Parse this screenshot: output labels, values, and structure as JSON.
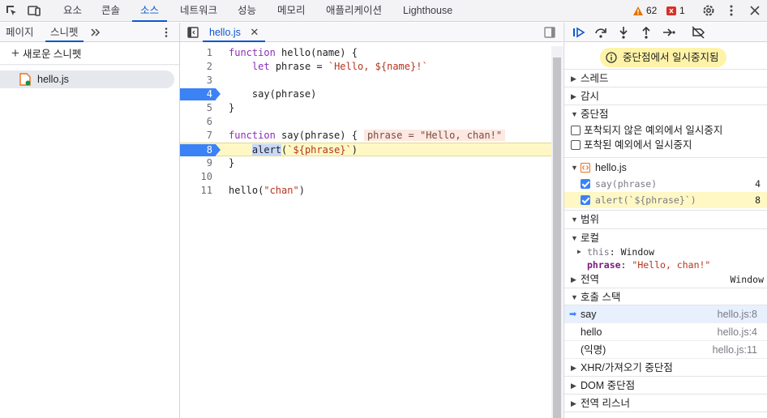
{
  "top_tabs": [
    "요소",
    "콘솔",
    "소스",
    "네트워크",
    "성능",
    "메모리",
    "애플리케이션",
    "Lighthouse"
  ],
  "active_tab": "소스",
  "warnings_count": "62",
  "errors_count": "1",
  "left_panel": {
    "tabs": [
      "페이지",
      "스니펫"
    ],
    "new_snippet_label": "새로운 스니펫",
    "file": "hello.js"
  },
  "editor": {
    "tab_label": "hello.js",
    "lines": [
      {
        "n": "1",
        "code": "function hello(name) {"
      },
      {
        "n": "2",
        "code": "    let phrase = `Hello, ${name}!`"
      },
      {
        "n": "3",
        "code": ""
      },
      {
        "n": "4",
        "code": "    say(phrase)"
      },
      {
        "n": "5",
        "code": "}"
      },
      {
        "n": "6",
        "code": ""
      },
      {
        "n": "7",
        "code": "function say(phrase) {"
      },
      {
        "n": "8",
        "code": "    alert(`${phrase}`)"
      },
      {
        "n": "9",
        "code": "}"
      },
      {
        "n": "10",
        "code": ""
      },
      {
        "n": "11",
        "code": "hello(\"chan\")"
      }
    ],
    "inline_value": "phrase = \"Hello, chan!\""
  },
  "debugger": {
    "paused_message": "중단점에서 일시중지됨",
    "threads": "스레드",
    "watch": "감시",
    "breakpoints": "중단점",
    "pause_uncaught": "포착되지 않은 예외에서 일시중지",
    "pause_caught": "포착된 예외에서 일시중지",
    "bp_file": "hello.js",
    "bp_items": [
      {
        "code": "say(phrase)",
        "line": "4"
      },
      {
        "code": "alert(`${phrase}`)",
        "line": "8"
      }
    ],
    "scope": "범위",
    "local": "로컬",
    "this_key": "this",
    "this_val": "Window",
    "phrase_key": "phrase",
    "phrase_val": "\"Hello, chan!\"",
    "global": "전역",
    "global_val": "Window",
    "call_stack": "호출 스택",
    "frames": [
      {
        "name": "say",
        "loc": "hello.js:8"
      },
      {
        "name": "hello",
        "loc": "hello.js:4"
      },
      {
        "name": "(익명)",
        "loc": "hello.js:11"
      }
    ],
    "xhr": "XHR/가져오기 중단점",
    "dom": "DOM 중단점",
    "global_listeners": "전역 리스너"
  },
  "colors": {
    "accent": "#0b57d0",
    "breakpoint": "#3b82f6",
    "paused_line": "#fff8c5"
  }
}
